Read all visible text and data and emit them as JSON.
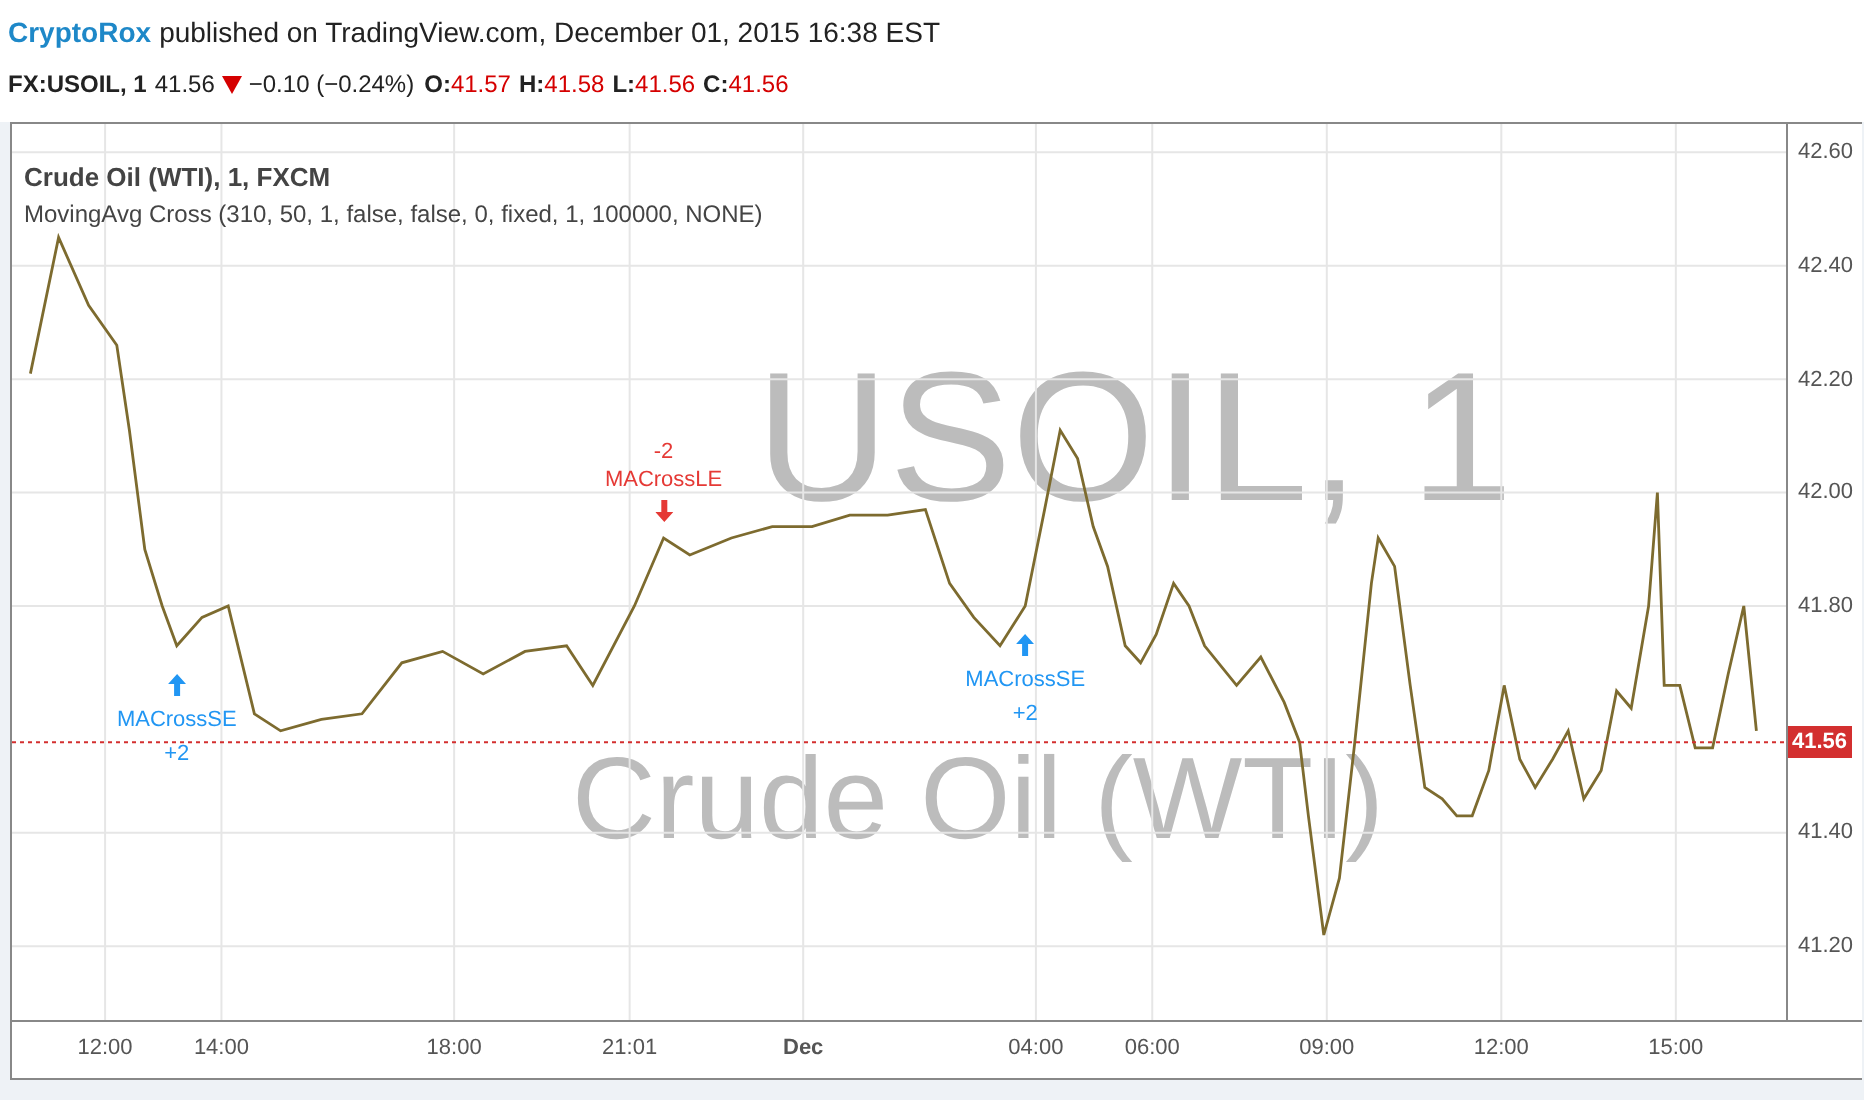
{
  "header": {
    "author": "CryptoRox",
    "published": "published on TradingView.com, December 01, 2015 16:38 EST"
  },
  "quote": {
    "symbol": "FX:USOIL, 1",
    "last": "41.56",
    "kind": "down",
    "change": "−0.10 (−0.24%)",
    "ohlc": [
      {
        "label": "O:",
        "value": "41.57"
      },
      {
        "label": "H:",
        "value": "41.58"
      },
      {
        "label": "L:",
        "value": "41.56"
      },
      {
        "label": "C:",
        "value": "41.56"
      }
    ]
  },
  "chart": {
    "legend": {
      "title": "Crude Oil (WTI), 1, FXCM",
      "study": "MovingAvg Cross (310, 50, 1, false, false, 0, fixed, 1, 100000, NONE)"
    },
    "watermark": {
      "symbol": "USOIL, 1",
      "description": "Crude Oil (WTI)"
    },
    "signals": [
      {
        "kind": "up",
        "quantity": "+2",
        "color": "#2196f3"
      },
      {
        "kind": "down",
        "quantity": "-2",
        "color": "#e53935"
      },
      {
        "kind": "up",
        "quantity": "+2",
        "color": "#2196f3"
      }
    ],
    "chart_data": {
      "type": "line",
      "grid": true,
      "ref_lines": [
        {
          "axis": "y",
          "value": 41.56,
          "label": "41.56",
          "color": "#d32f2f"
        }
      ],
      "xlim": [
        "2015-11-30T10:24",
        "2015-12-01T18:12"
      ],
      "ylim": [
        41.07,
        42.65
      ],
      "x": [
        "2015-11-30T10:43",
        "2015-11-30T11:12",
        "2015-11-30T11:43",
        "2015-11-30T12:12",
        "2015-11-30T12:25",
        "2015-11-30T12:41",
        "2015-11-30T12:59",
        "2015-11-30T13:14",
        "2015-11-30T13:40",
        "2015-11-30T14:07",
        "2015-11-30T14:34",
        "2015-11-30T15:01",
        "2015-11-30T15:43",
        "2015-11-30T16:25",
        "2015-11-30T17:06",
        "2015-11-30T17:48",
        "2015-11-30T18:30",
        "2015-11-30T19:13",
        "2015-11-30T19:56",
        "2015-11-30T20:23",
        "2015-11-30T21:06",
        "2015-11-30T21:36",
        "2015-11-30T22:03",
        "2015-11-30T22:46",
        "2015-11-30T23:28",
        "2015-12-01T00:09",
        "2015-12-01T00:48",
        "2015-12-01T01:27",
        "2015-12-01T02:06",
        "2015-12-01T02:31",
        "2015-12-01T02:56",
        "2015-12-01T03:23",
        "2015-12-01T03:49",
        "2015-12-01T04:09",
        "2015-12-01T04:25",
        "2015-12-01T04:43",
        "2015-12-01T04:59",
        "2015-12-01T05:14",
        "2015-12-01T05:32",
        "2015-12-01T05:48",
        "2015-12-01T06:04",
        "2015-12-01T06:22",
        "2015-12-01T06:38",
        "2015-12-01T06:54",
        "2015-12-01T07:27",
        "2015-12-01T07:52",
        "2015-12-01T08:16",
        "2015-12-01T08:32",
        "2015-12-01T08:41",
        "2015-12-01T08:57",
        "2015-12-01T09:13",
        "2015-12-01T09:29",
        "2015-12-01T09:46",
        "2015-12-01T09:53",
        "2015-12-01T10:10",
        "2015-12-01T10:26",
        "2015-12-01T10:41",
        "2015-12-01T10:59",
        "2015-12-01T11:14",
        "2015-12-01T11:30",
        "2015-12-01T11:47",
        "2015-12-01T12:03",
        "2015-12-01T12:19",
        "2015-12-01T12:35",
        "2015-12-01T12:53",
        "2015-12-01T13:09",
        "2015-12-01T13:25",
        "2015-12-01T13:43",
        "2015-12-01T13:59",
        "2015-12-01T14:14",
        "2015-12-01T14:32",
        "2015-12-01T14:41",
        "2015-12-01T14:48",
        "2015-12-01T15:04",
        "2015-12-01T15:20",
        "2015-12-01T15:38",
        "2015-12-01T15:54",
        "2015-12-01T16:10",
        "2015-12-01T16:23"
      ],
      "series": [
        {
          "color": "#7d6b2f",
          "values": [
            42.21,
            42.45,
            42.33,
            42.26,
            42.11,
            41.9,
            41.8,
            41.73,
            41.78,
            41.8,
            41.61,
            41.58,
            41.6,
            41.61,
            41.7,
            41.72,
            41.68,
            41.72,
            41.73,
            41.66,
            41.8,
            41.92,
            41.89,
            41.92,
            41.94,
            41.94,
            41.96,
            41.96,
            41.97,
            41.84,
            41.78,
            41.73,
            41.8,
            41.97,
            42.11,
            42.06,
            41.94,
            41.87,
            41.73,
            41.7,
            41.75,
            41.84,
            41.8,
            41.73,
            41.66,
            41.71,
            41.63,
            41.56,
            41.43,
            41.22,
            41.32,
            41.56,
            41.84,
            41.92,
            41.87,
            41.66,
            41.48,
            41.46,
            41.43,
            41.43,
            41.51,
            41.66,
            41.53,
            41.48,
            41.53,
            41.58,
            41.46,
            41.51,
            41.65,
            41.62,
            41.8,
            42.0,
            41.66,
            41.66,
            41.55,
            41.55,
            41.68,
            41.8,
            41.58
          ]
        }
      ],
      "xticks": [
        {
          "value": "2015-11-30T12:00",
          "label": "12:00"
        },
        {
          "value": "2015-11-30T14:00",
          "label": "14:00"
        },
        {
          "value": "2015-11-30T18:00",
          "label": "18:00"
        },
        {
          "value": "2015-11-30T21:01",
          "label": "21:01"
        },
        {
          "value": "2015-12-01T00:00",
          "label": "Dec"
        },
        {
          "value": "2015-12-01T04:00",
          "label": "04:00"
        },
        {
          "value": "2015-12-01T06:00",
          "label": "06:00"
        },
        {
          "value": "2015-12-01T09:00",
          "label": "09:00"
        },
        {
          "value": "2015-12-01T12:00",
          "label": "12:00"
        },
        {
          "value": "2015-12-01T15:00",
          "label": "15:00"
        }
      ],
      "yticks": [
        {
          "value": 42.6,
          "label": "42.60"
        },
        {
          "value": 42.4,
          "label": "42.40"
        },
        {
          "value": 42.2,
          "label": "42.20"
        },
        {
          "value": 42.0,
          "label": "42.00"
        },
        {
          "value": 41.8,
          "label": "41.80"
        },
        {
          "value": 41.4,
          "label": "41.40"
        },
        {
          "value": 41.2,
          "label": "41.20"
        }
      ],
      "annotations": [
        {
          "x": "2015-11-30T13:14",
          "y": 41.73,
          "text": "MACrossSE"
        },
        {
          "x": "2015-11-30T21:36",
          "y": 41.92,
          "text": "MACrossLE"
        },
        {
          "x": "2015-12-01T03:49",
          "y": 41.8,
          "text": "MACrossSE"
        }
      ]
    }
  }
}
